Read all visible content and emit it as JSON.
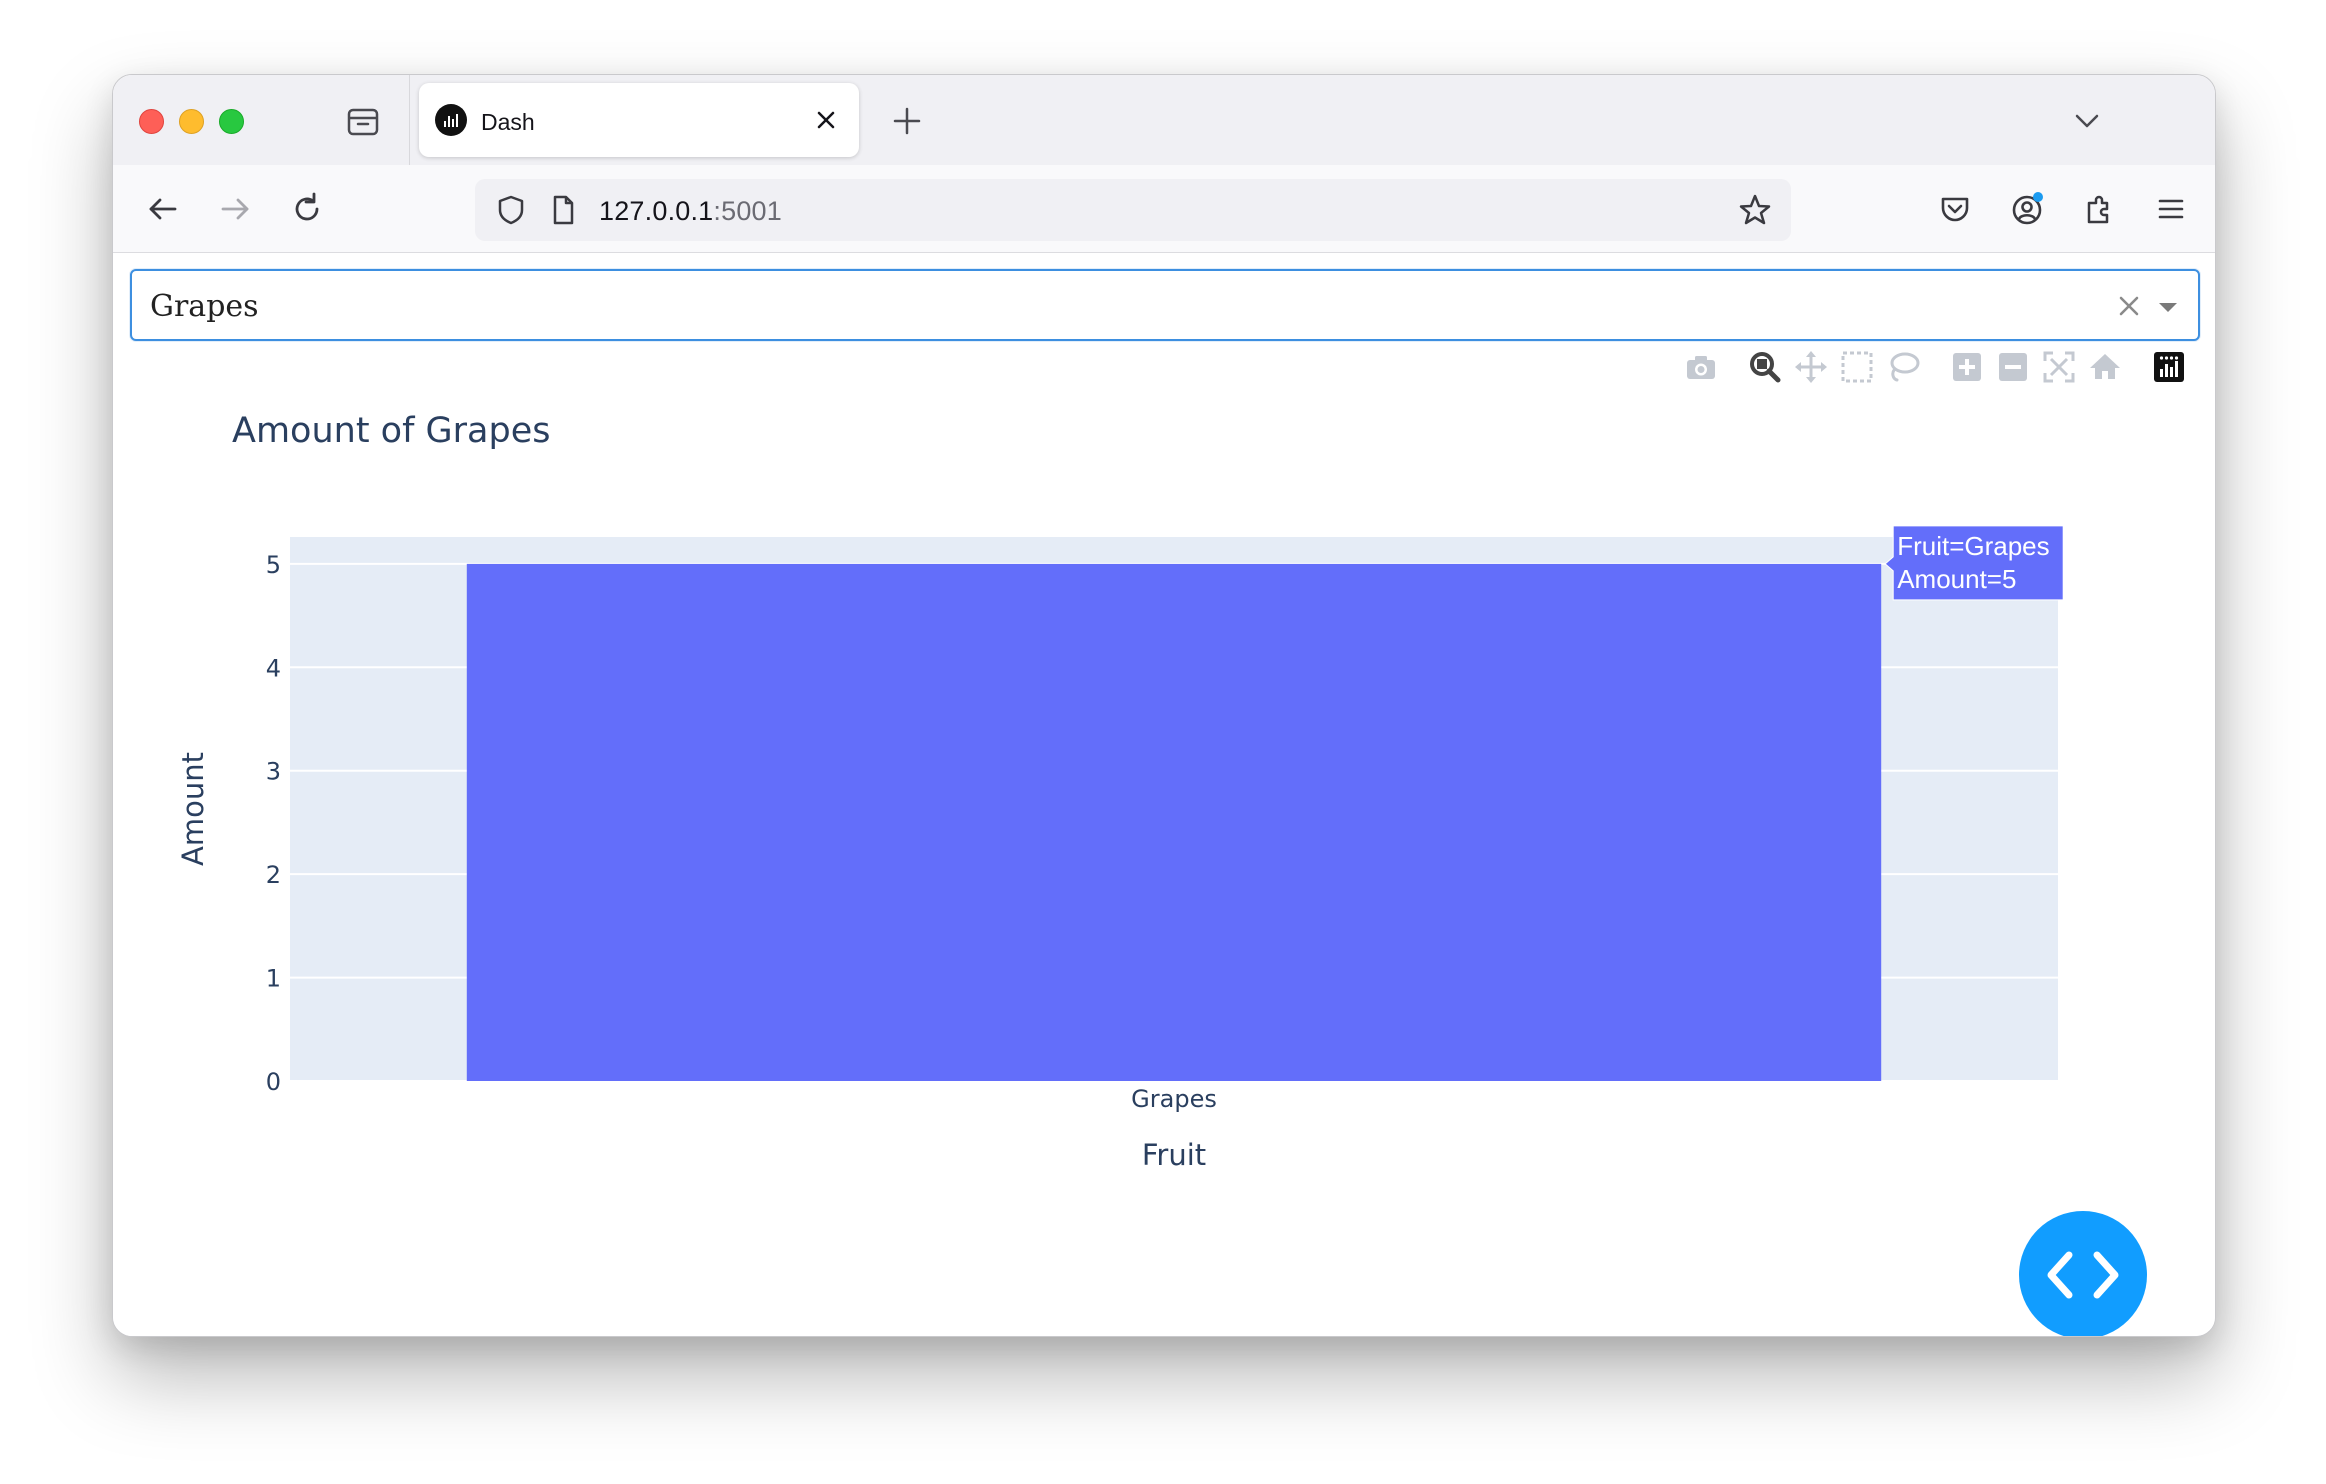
{
  "browser": {
    "tab_title": "Dash",
    "url_host": "127.0.0.1",
    "url_port": ":5001"
  },
  "dropdown": {
    "selected": "Grapes"
  },
  "chart_data": {
    "type": "bar",
    "title": "Amount of Grapes",
    "xlabel": "Fruit",
    "ylabel": "Amount",
    "categories": [
      "Grapes"
    ],
    "values": [
      5
    ],
    "ylim": [
      0,
      5.26
    ],
    "yticks": [
      0,
      1,
      2,
      3,
      4,
      5
    ],
    "grid": true,
    "bar_color": "#636efa",
    "plot_bg": "#e5ecf6",
    "hover": {
      "line1": "Fruit=Grapes",
      "line2": "Amount=5"
    }
  },
  "colors": {
    "accent": "#119dff",
    "focus_border": "#3d8fe0",
    "axis_text": "#2a3f5f"
  }
}
